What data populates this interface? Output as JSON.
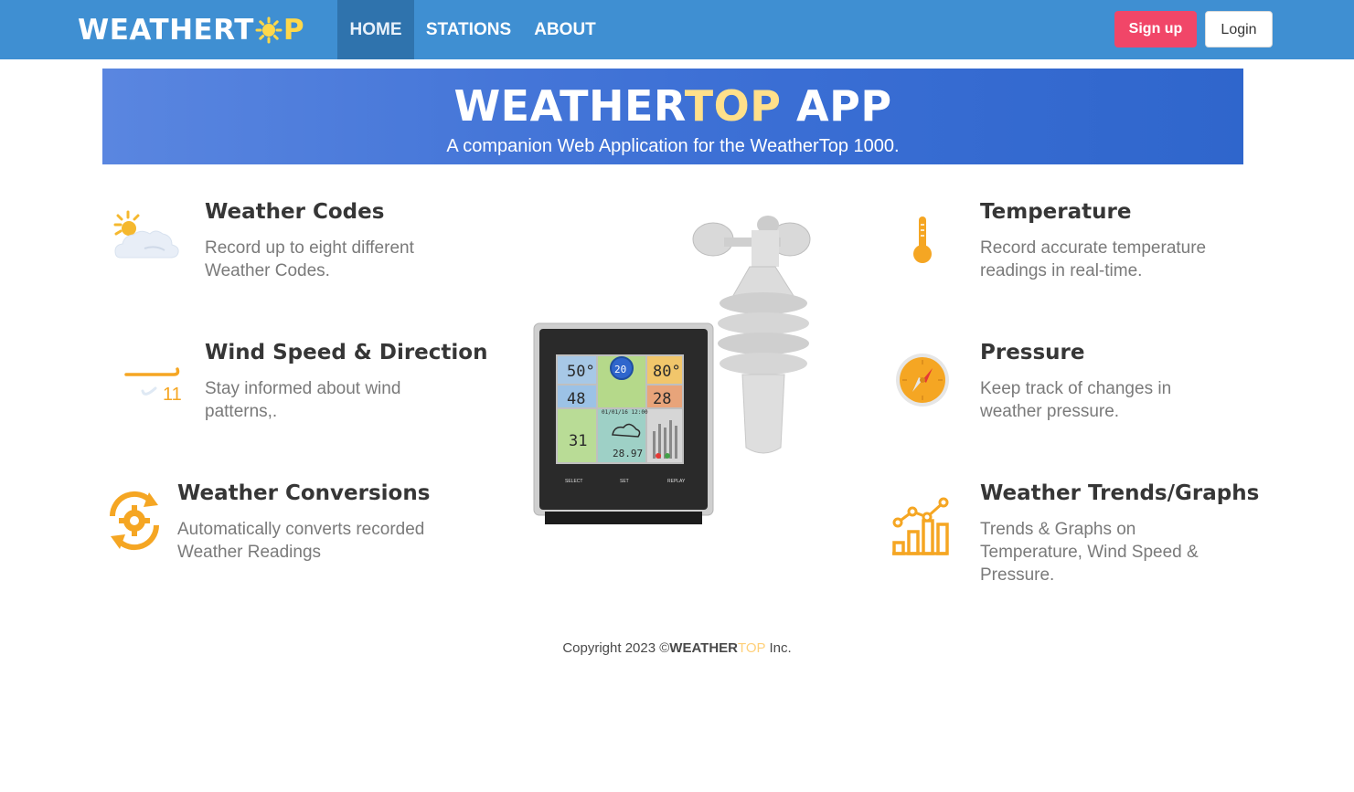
{
  "nav": {
    "brand_part1": "WEATHERT",
    "brand_part2": "P",
    "home": "HOME",
    "stations": "STATIONS",
    "about": "ABOUT",
    "signup": "Sign up",
    "login": "Login"
  },
  "hero": {
    "title_part1": "WEATHER",
    "title_part2": "TOP",
    "title_part3": " APP",
    "subtitle": "A companion Web Application for the WeatherTop 1000."
  },
  "features": {
    "weather_codes": {
      "title": "Weather Codes",
      "desc": "Record up to eight different Weather Codes."
    },
    "wind": {
      "title": "Wind Speed & Direction",
      "desc": "Stay informed about wind patterns,."
    },
    "conversions": {
      "title": "Weather Conversions",
      "desc": "Automatically converts recorded Weather Readings"
    },
    "temperature": {
      "title": "Temperature",
      "desc": "Record accurate temperature readings in real-time."
    },
    "pressure": {
      "title": "Pressure",
      "desc": "Keep track of changes in weather pressure."
    },
    "trends": {
      "title": "Weather Trends/Graphs",
      "desc": "Trends & Graphs on Temperature, Wind Speed & Pressure."
    }
  },
  "station_display": {
    "temp_out": "50°",
    "wind": "20",
    "temp_in": "80°",
    "humidity_out": "48",
    "humidity_in": "28",
    "datetime": "01/01/16 12:00",
    "wind_chill": "31",
    "pressure": "28.97",
    "btn_select": "SELECT",
    "btn_set": "SET",
    "btn_replay": "REPLAY"
  },
  "wind_icon_value": "11",
  "footer": {
    "prefix": "Copyright 2023 ©",
    "brand1": "WEATHER",
    "brand2": "TOP",
    "suffix": " Inc."
  },
  "colors": {
    "navbar": "#3f8fd2",
    "nav_active": "#2f73ad",
    "signup": "#f14668",
    "accent_yellow": "#ffd84a",
    "icon_orange": "#f5a623"
  }
}
